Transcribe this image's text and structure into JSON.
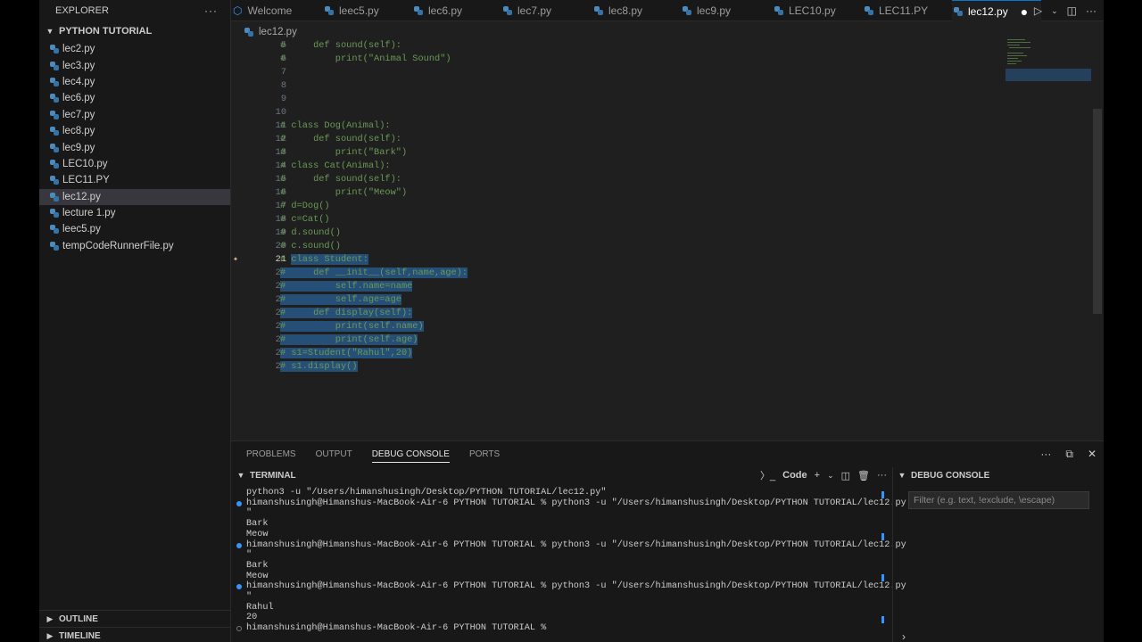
{
  "explorer": {
    "title": "EXPLORER",
    "more": "···",
    "folder": "PYTHON TUTORIAL",
    "files": [
      "lec2.py",
      "lec3.py",
      "lec4.py",
      "lec6.py",
      "lec7.py",
      "lec8.py",
      "lec9.py",
      "LEC10.py",
      "LEC11.PY",
      "lec12.py",
      "lecture 1.py",
      "leec5.py",
      "tempCodeRunnerFile.py"
    ],
    "active_file": "lec12.py",
    "outline": "OUTLINE",
    "timeline": "TIMELINE"
  },
  "tabs": [
    "Welcome",
    "leec5.py",
    "lec6.py",
    "lec7.py",
    "lec8.py",
    "lec9.py",
    "LEC10.py",
    "LEC11.PY",
    "lec12.py"
  ],
  "active_tab": "lec12.py",
  "breadcrumb": "lec12.py",
  "editor": {
    "current_line": 21,
    "lines": [
      {
        "n": "5",
        "text": "#     def sound(self):",
        "sel": ""
      },
      {
        "n": "6",
        "text": "#         print(\"Animal Sound\")",
        "sel": ""
      },
      {
        "n": "7",
        "text": "",
        "sel": ""
      },
      {
        "n": "8",
        "text": "",
        "sel": ""
      },
      {
        "n": "9",
        "text": "",
        "sel": ""
      },
      {
        "n": "10",
        "text": "",
        "sel": ""
      },
      {
        "n": "11",
        "text": "# class Dog(Animal):",
        "sel": ""
      },
      {
        "n": "12",
        "text": "#     def sound(self):",
        "sel": ""
      },
      {
        "n": "13",
        "text": "#         print(\"Bark\")",
        "sel": ""
      },
      {
        "n": "14",
        "text": "# class Cat(Animal):",
        "sel": ""
      },
      {
        "n": "15",
        "text": "#     def sound(self):",
        "sel": ""
      },
      {
        "n": "16",
        "text": "#         print(\"Meow\")",
        "sel": ""
      },
      {
        "n": "17",
        "text": "# d=Dog()",
        "sel": ""
      },
      {
        "n": "18",
        "text": "# c=Cat()",
        "sel": ""
      },
      {
        "n": "19",
        "text": "# d.sound()",
        "sel": ""
      },
      {
        "n": "20",
        "text": "# c.sound()",
        "sel": ""
      },
      {
        "n": "21",
        "text": "# ",
        "sel": "class Student:"
      },
      {
        "n": "22",
        "text": "",
        "sel": "#     def __init__(self,name,age):"
      },
      {
        "n": "23",
        "text": "",
        "sel": "#         self.name=name"
      },
      {
        "n": "24",
        "text": "",
        "sel": "#         self.age=age"
      },
      {
        "n": "25",
        "text": "",
        "sel": "#     def display(self):"
      },
      {
        "n": "26",
        "text": "",
        "sel": "#         print(self.name)"
      },
      {
        "n": "27",
        "text": "",
        "sel": "#         print(self.age)"
      },
      {
        "n": "28",
        "text": "",
        "sel": "# s1=Student(\"Rahul\",20)"
      },
      {
        "n": "29",
        "text": "",
        "sel": "# s1.display()"
      }
    ]
  },
  "panel": {
    "tabs": [
      "PROBLEMS",
      "OUTPUT",
      "DEBUG CONSOLE",
      "PORTS"
    ],
    "active_tab": "DEBUG CONSOLE",
    "terminal_title": "TERMINAL",
    "terminal_profile": "Code",
    "debug_title": "DEBUG CONSOLE",
    "filter_placeholder": "Filter (e.g. text, !exclude, \\escape)",
    "terminal_lines": [
      {
        "text": "python3 -u \"/Users/himanshusingh/Desktop/PYTHON TUTORIAL/lec12.py\"",
        "dot": ""
      },
      {
        "text": "himanshusingh@Himanshus-MacBook-Air-6 PYTHON TUTORIAL % python3 -u \"/Users/himanshusingh/Desktop/PYTHON TUTORIAL/lec12.py",
        "dot": "blue"
      },
      {
        "text": "\"",
        "dot": ""
      },
      {
        "text": "Bark",
        "dot": ""
      },
      {
        "text": "Meow",
        "dot": ""
      },
      {
        "text": "himanshusingh@Himanshus-MacBook-Air-6 PYTHON TUTORIAL % python3 -u \"/Users/himanshusingh/Desktop/PYTHON TUTORIAL/lec12.py",
        "dot": "blue"
      },
      {
        "text": "\"",
        "dot": ""
      },
      {
        "text": "Bark",
        "dot": ""
      },
      {
        "text": "Meow",
        "dot": ""
      },
      {
        "text": "himanshusingh@Himanshus-MacBook-Air-6 PYTHON TUTORIAL % python3 -u \"/Users/himanshusingh/Desktop/PYTHON TUTORIAL/lec12.py",
        "dot": "blue"
      },
      {
        "text": "\"",
        "dot": ""
      },
      {
        "text": "Rahul",
        "dot": ""
      },
      {
        "text": "20",
        "dot": ""
      },
      {
        "text": "himanshusingh@Himanshus-MacBook-Air-6 PYTHON TUTORIAL % ",
        "dot": "hollow"
      }
    ]
  },
  "colors": {
    "comment": "#6a9955",
    "selection": "#264f78",
    "accent": "#0078d4"
  }
}
